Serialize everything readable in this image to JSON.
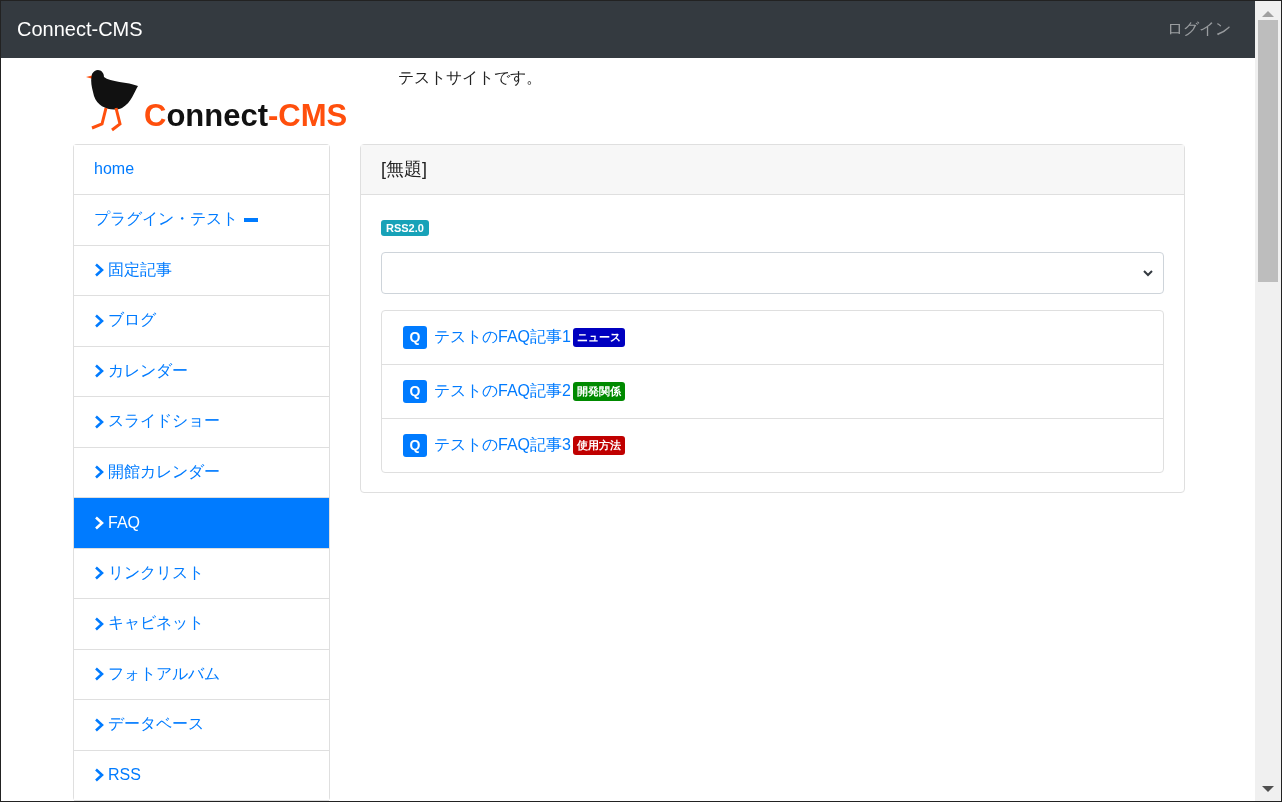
{
  "navbar": {
    "brand": "Connect-CMS",
    "login": "ログイン"
  },
  "header": {
    "logo": [
      {
        "kind": "accent",
        "text": "C"
      },
      {
        "kind": "plain",
        "text": "onnect"
      },
      {
        "kind": "accent",
        "text": "-CMS"
      }
    ],
    "tagline": "テストサイトです。"
  },
  "sidebar": {
    "items": [
      {
        "label": "home",
        "kind": "page",
        "selected": false,
        "expanded": false
      },
      {
        "label": "プラグイン・テスト",
        "kind": "page",
        "selected": false,
        "expanded": true
      },
      {
        "label": "固定記事",
        "kind": "child",
        "selected": false,
        "expanded": false
      },
      {
        "label": "ブログ",
        "kind": "child",
        "selected": false,
        "expanded": false
      },
      {
        "label": "カレンダー",
        "kind": "child",
        "selected": false,
        "expanded": false
      },
      {
        "label": "スライドショー",
        "kind": "child",
        "selected": false,
        "expanded": false
      },
      {
        "label": "開館カレンダー",
        "kind": "child",
        "selected": false,
        "expanded": false
      },
      {
        "label": "FAQ",
        "kind": "child",
        "selected": true,
        "expanded": false
      },
      {
        "label": "リンクリスト",
        "kind": "child",
        "selected": false,
        "expanded": false
      },
      {
        "label": "キャビネット",
        "kind": "child",
        "selected": false,
        "expanded": false
      },
      {
        "label": "フォトアルバム",
        "kind": "child",
        "selected": false,
        "expanded": false
      },
      {
        "label": "データベース",
        "kind": "child",
        "selected": false,
        "expanded": false
      },
      {
        "label": "RSS",
        "kind": "child",
        "selected": false,
        "expanded": false
      }
    ]
  },
  "panel": {
    "title": "[無題]",
    "rss_badge": "RSS2.0",
    "faqs": [
      {
        "q": "Q",
        "title": "テストのFAQ記事1",
        "tag": "ニュース",
        "color": "#0000c0"
      },
      {
        "q": "Q",
        "title": "テストのFAQ記事2",
        "tag": "開発関係",
        "color": "#008a00"
      },
      {
        "q": "Q",
        "title": "テストのFAQ記事3",
        "tag": "使用方法",
        "color": "#c00000"
      }
    ]
  }
}
